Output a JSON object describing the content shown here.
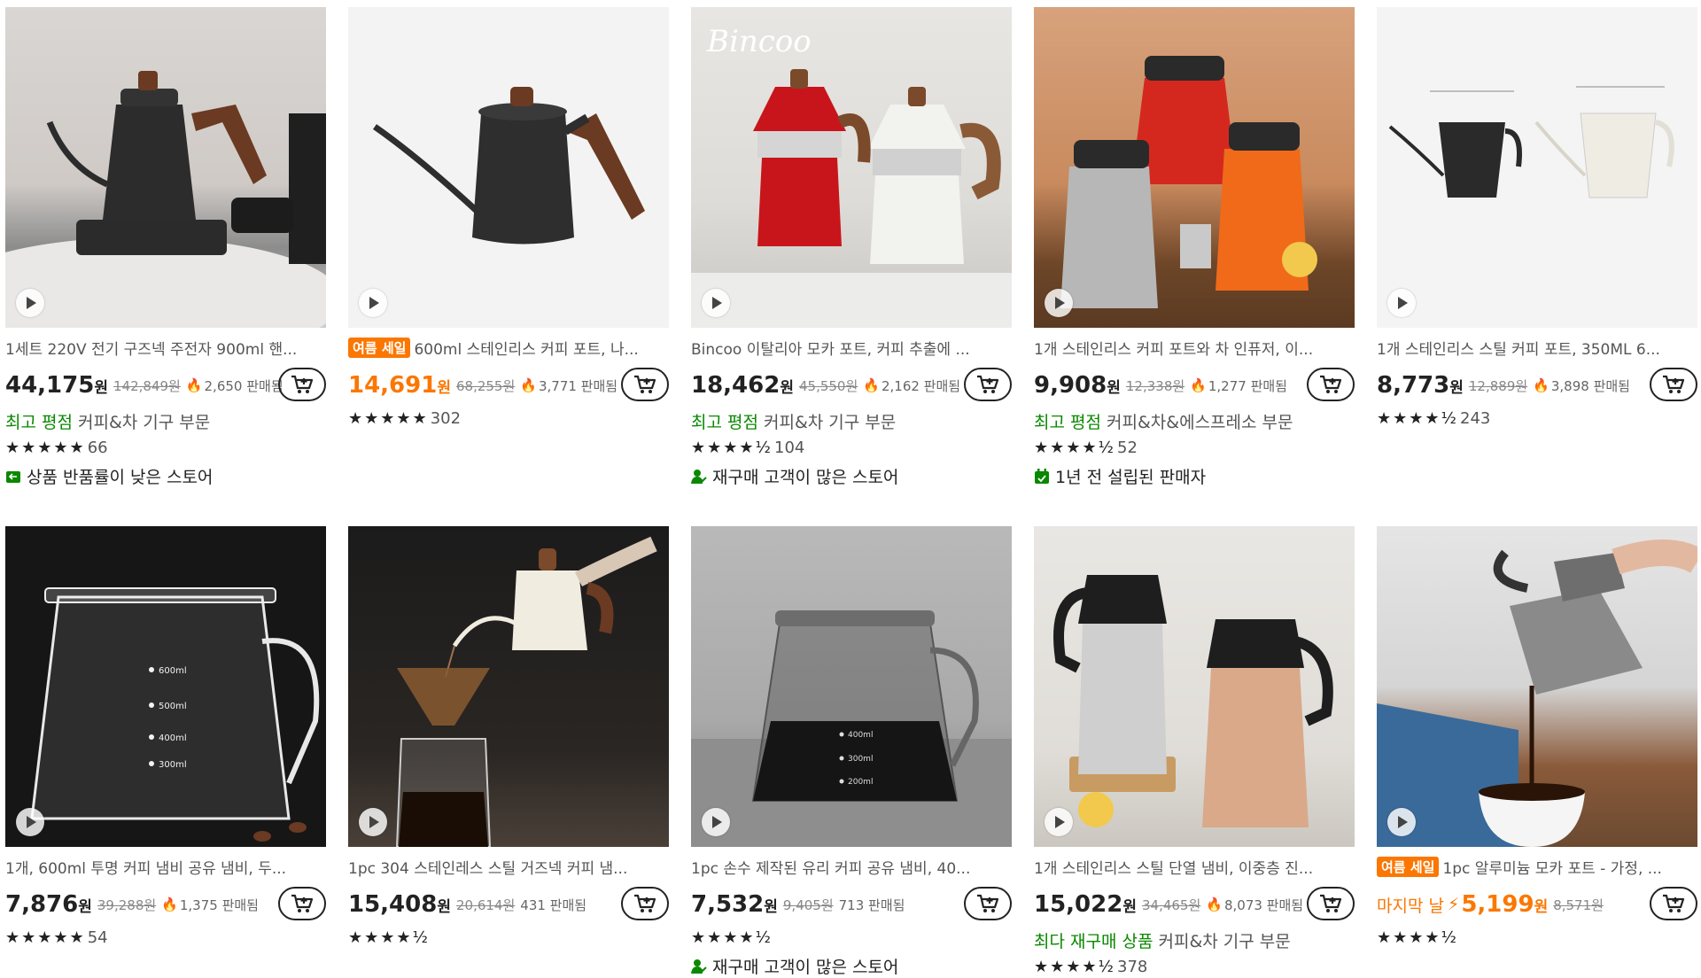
{
  "products": [
    {
      "title": "1세트 220V 전기 구즈넥 주전자 900ml 핸...",
      "badge": "",
      "price": "44,175",
      "won": "원",
      "orig": "142,849원",
      "sold": "2,650 판매됨",
      "tag_green": "최고 평점",
      "tag_rest": "커피&차 기구 부문",
      "stars": "★★★★★",
      "rating_count": "66",
      "feature": "상품 반품률이 낮은 스토어",
      "feature_icon": "return-icon"
    },
    {
      "title": "600ml 스테인리스 커피 포트, 나...",
      "badge": "여름 세일",
      "price": "14,691",
      "won": "원",
      "orig": "68,255원",
      "sold": "3,771 판매됨",
      "tag_green": "",
      "tag_rest": "",
      "stars": "★★★★★",
      "rating_count": "302",
      "feature": "",
      "feature_icon": ""
    },
    {
      "title": "Bincoo 이탈리아 모카 포트, 커피 추출에 ...",
      "badge": "",
      "price": "18,462",
      "won": "원",
      "orig": "45,550원",
      "sold": "2,162 판매됨",
      "tag_green": "최고 평점",
      "tag_rest": "커피&차 기구 부문",
      "stars": "★★★★½",
      "rating_count": "104",
      "feature": "재구매 고객이 많은 스토어",
      "feature_icon": "repeat-customer-icon"
    },
    {
      "title": "1개 스테인리스 커피 포트와 차 인퓨저, 이...",
      "badge": "",
      "price": "9,908",
      "won": "원",
      "orig": "12,338원",
      "sold": "1,277 판매됨",
      "tag_green": "최고 평점",
      "tag_rest": "커피&차&에스프레소 부문",
      "stars": "★★★★½",
      "rating_count": "52",
      "feature": "1년 전 설립된 판매자",
      "feature_icon": "calendar-icon"
    },
    {
      "title": "1개 스테인리스 스틸 커피 포트, 350ML 6...",
      "badge": "",
      "price": "8,773",
      "won": "원",
      "orig": "12,889원",
      "sold": "3,898 판매됨",
      "tag_green": "",
      "tag_rest": "",
      "stars": "★★★★½",
      "rating_count": "243",
      "feature": "",
      "feature_icon": ""
    },
    {
      "title": "1개, 600ml 투명 커피 냄비 공유 냄비, 두...",
      "badge": "",
      "price": "7,876",
      "won": "원",
      "orig": "39,288원",
      "sold": "1,375 판매됨",
      "tag_green": "",
      "tag_rest": "",
      "stars": "★★★★★",
      "rating_count": "54",
      "feature": "",
      "feature_icon": ""
    },
    {
      "title": "1pc 304 스테인레스 스틸 거즈넥 커피 냄...",
      "badge": "",
      "price": "15,408",
      "won": "원",
      "orig": "20,614원",
      "sold": "431 판매됨",
      "tag_green": "",
      "tag_rest": "",
      "stars": "★★★★½",
      "rating_count": "",
      "feature": "",
      "feature_icon": ""
    },
    {
      "title": "1pc 손수 제작된 유리 커피 공유 냄비, 40...",
      "badge": "",
      "price": "7,532",
      "won": "원",
      "orig": "9,405원",
      "sold": "713 판매됨",
      "tag_green": "",
      "tag_rest": "",
      "stars": "★★★★½",
      "rating_count": "",
      "feature": "재구매 고객이 많은 스토어",
      "feature_icon": "repeat-customer-icon"
    },
    {
      "title": "1개 스테인리스 스틸 단열 냄비, 이중층 진...",
      "badge": "",
      "price": "15,022",
      "won": "원",
      "orig": "34,465원",
      "sold": "8,073 판매됨",
      "tag_green": "최다 재구매 상품",
      "tag_rest": "커피&차 기구 부문",
      "stars": "★★★★½",
      "rating_count": "378",
      "feature": "",
      "feature_icon": ""
    },
    {
      "title": "1pc 알루미늄 모카 포트 - 가정, ...",
      "badge": "여름 세일",
      "price": "5,199",
      "won": "원",
      "orig": "8,571원",
      "sold": "",
      "flash": "마지막 날",
      "tag_green": "",
      "tag_rest": "",
      "stars": "★★★★½",
      "rating_count": "",
      "feature": "",
      "feature_icon": ""
    }
  ],
  "colors": {
    "accent": "#fb7701",
    "green": "#0a8800"
  }
}
